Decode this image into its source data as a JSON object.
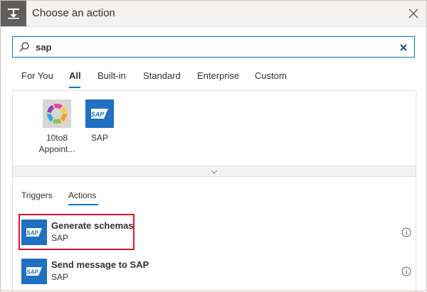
{
  "header": {
    "title": "Choose an action",
    "icon": "insert-action-icon"
  },
  "search": {
    "value": "sap",
    "placeholder": ""
  },
  "tabs": [
    {
      "label": "For You"
    },
    {
      "label": "All"
    },
    {
      "label": "Built-in"
    },
    {
      "label": "Standard"
    },
    {
      "label": "Enterprise"
    },
    {
      "label": "Custom"
    }
  ],
  "active_tab": "All",
  "connectors": [
    {
      "label_line1": "10to8",
      "label_line2": "Appoint..."
    },
    {
      "label_line1": "SAP",
      "label_line2": ""
    }
  ],
  "subtabs": [
    {
      "label": "Triggers"
    },
    {
      "label": "Actions"
    }
  ],
  "active_subtab": "Actions",
  "actions": [
    {
      "name": "Generate schemas",
      "connector": "SAP",
      "icon_text": "SAP"
    },
    {
      "name": "Send message to SAP",
      "connector": "SAP",
      "icon_text": "SAP"
    }
  ],
  "colors": {
    "accent": "#0078d4",
    "highlight": "#e81123",
    "sap_blue": "#1f70c1"
  }
}
